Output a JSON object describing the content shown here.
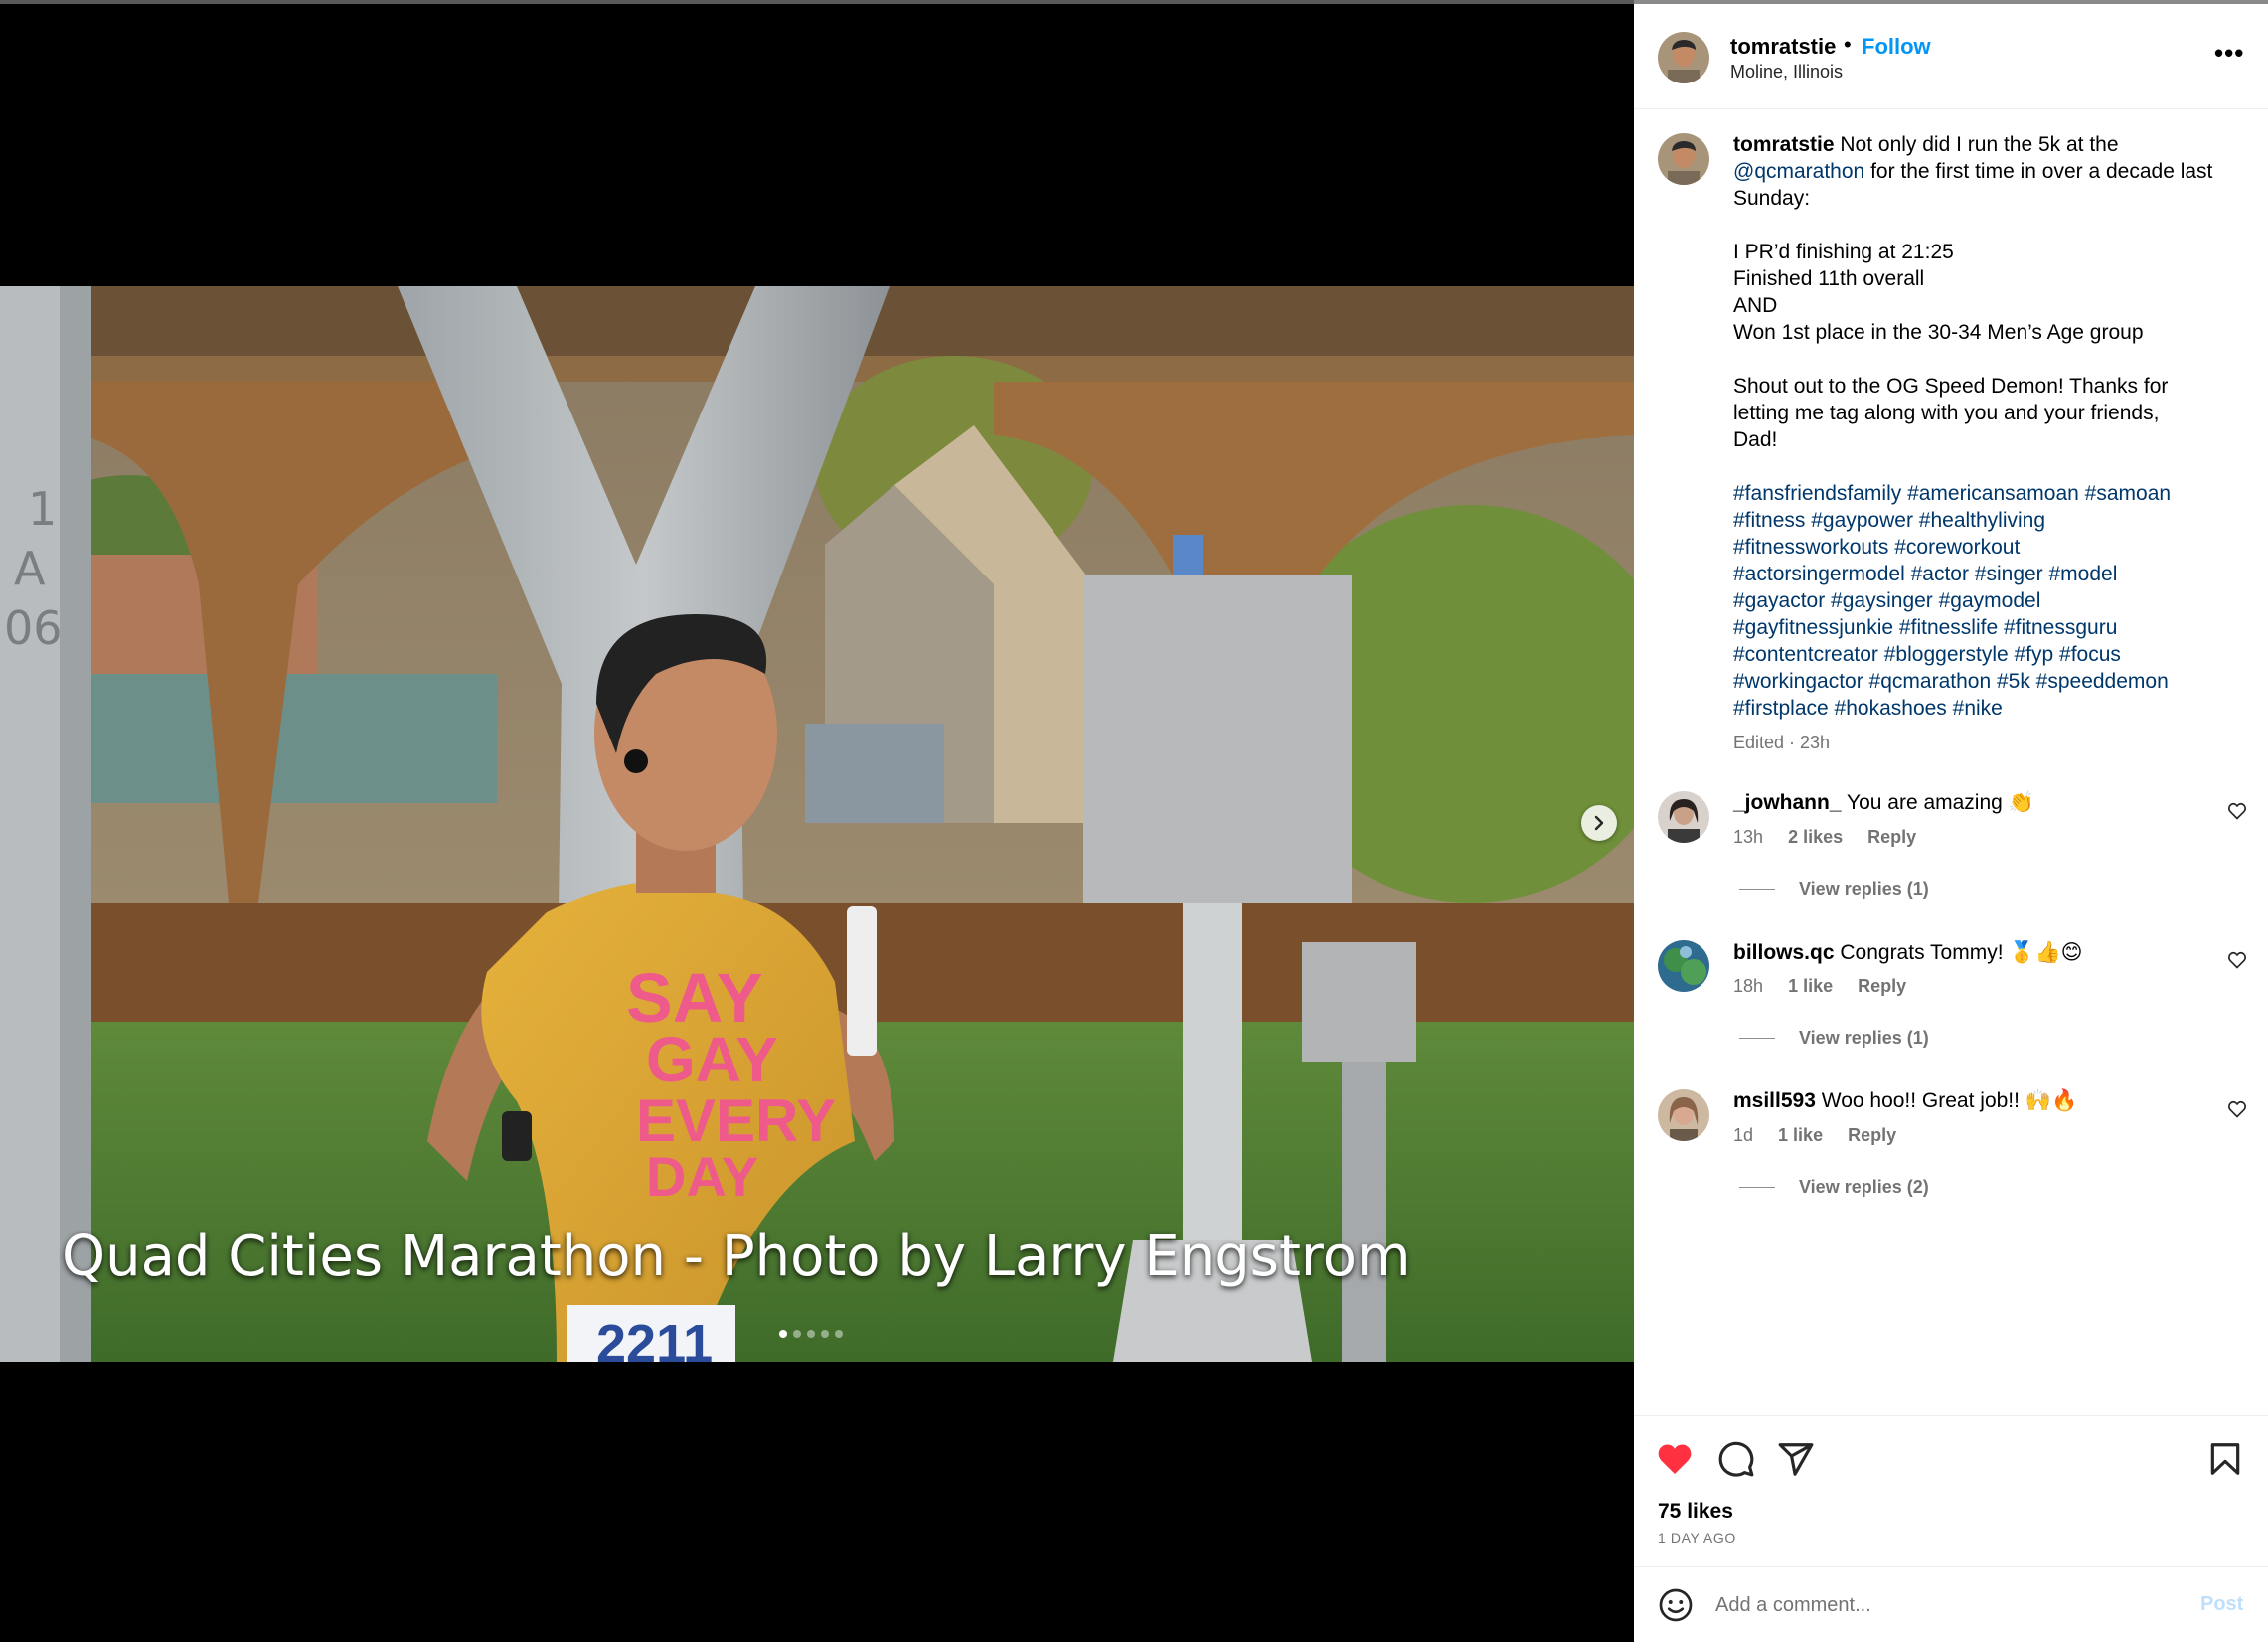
{
  "post": {
    "photo_caption": "Quad Cities Marathon - Photo by Larry Engstrom",
    "carousel_total": 5,
    "carousel_active": 1,
    "shirt_text": [
      "SAY",
      "GAY",
      "EVERY",
      "DAY"
    ],
    "pole_marking": [
      "1",
      "A",
      "06"
    ],
    "bib_text": "2211"
  },
  "header": {
    "username": "tomratstie",
    "separator": "•",
    "follow_label": "Follow",
    "location": "Moline, Illinois",
    "more_label": "•••"
  },
  "caption": {
    "username": "tomratstie",
    "intro": "Not only did I run the 5k at the",
    "mention": "@qcmarathon",
    "intro2": "for the first time in over a decade last Sunday:",
    "line1": "I PR’d finishing at 21:25",
    "line2": "Finished 11th overall",
    "line3": "AND",
    "line4": "Won 1st place in the 30-34 Men’s Age group",
    "shout1": "Shout out to the OG Speed Demon! Thanks for",
    "shout2": "letting me tag along with you and your friends,",
    "shout3": "Dad!",
    "hashtags": [
      "#fansfriendsfamily #americansamoan #samoan",
      "#fitness #gaypower #healthyliving",
      "#fitnessworkouts #coreworkout",
      "#actorsingermodel #actor #singer #model",
      "#gayactor #gaysinger #gaymodel",
      "#gayfitnessjunkie #fitnesslife #fitnessguru",
      "#contentcreator #bloggerstyle #fyp #focus",
      "#workingactor #qcmarathon #5k #speeddemon",
      "#firstplace #hokashoes #nike"
    ],
    "meta": "Edited · 23h"
  },
  "comments": [
    {
      "username": "_jowhann_",
      "text": "You are amazing 👏",
      "time": "13h",
      "likes": "2 likes",
      "reply": "Reply",
      "view_replies": "View replies (1)"
    },
    {
      "username": "billows.qc",
      "text": "Congrats Tommy! 🥇👍😊",
      "time": "18h",
      "likes": "1 like",
      "reply": "Reply",
      "view_replies": "View replies (1)"
    },
    {
      "username": "msill593",
      "text": "Woo hoo!! Great job!! 🙌🔥",
      "time": "1d",
      "likes": "1 like",
      "reply": "Reply",
      "view_replies": "View replies (2)"
    }
  ],
  "footer": {
    "likes": "75 likes",
    "posted": "1 DAY AGO",
    "comment_placeholder": "Add a comment...",
    "post_label": "Post"
  },
  "colors": {
    "accent": "#0095f6",
    "heart": "#ff3040",
    "link": "#00376b",
    "muted": "#737373",
    "post_disabled": "#c0dffd"
  },
  "icons": {
    "like": "heart-filled-icon",
    "comment": "speech-bubble-icon",
    "share": "paper-plane-icon",
    "save": "bookmark-icon",
    "emoji": "smiley-icon",
    "next": "chevron-right-icon",
    "comment_like": "heart-outline-icon",
    "more": "more-dots-icon"
  }
}
